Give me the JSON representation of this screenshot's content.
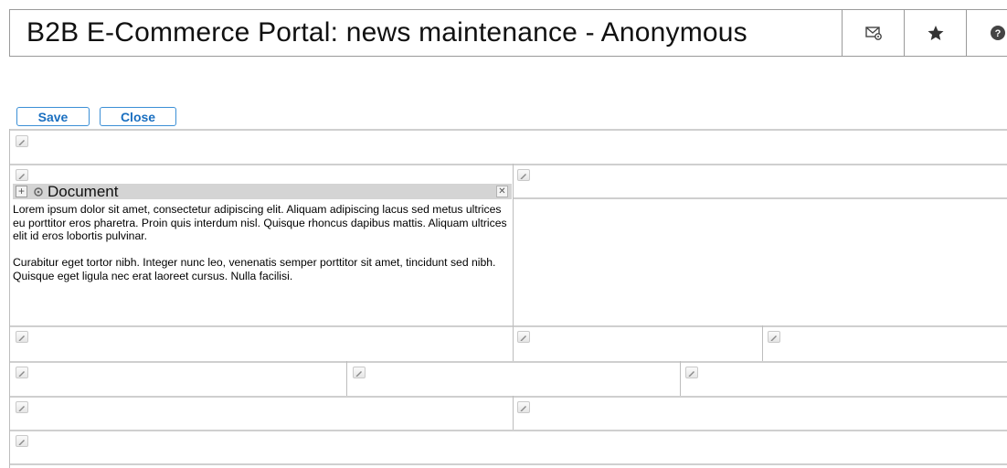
{
  "header": {
    "title": "B2B E-Commerce Portal: news maintenance - Anonymous",
    "icons": [
      "mail-settings-icon",
      "star-icon",
      "help-icon"
    ]
  },
  "toolbar": {
    "save_label": "Save",
    "close_label": "Close"
  },
  "document": {
    "title": "Document",
    "paragraphs": [
      "Lorem ipsum dolor sit amet, consectetur adipiscing elit. Aliquam adipiscing lacus sed metus ultrices eu porttitor eros pharetra. Proin quis interdum nisl. Quisque rhoncus dapibus mattis. Aliquam ultrices elit id eros lobortis pulvinar.",
      "Curabitur eget tortor nibh. Integer nunc leo, venenatis semper porttitor sit amet, tincidunt sed nibh. Quisque eget ligula nec erat laoreet cursus. Nulla facilisi."
    ]
  },
  "colors": {
    "button_border": "#3b8fd6",
    "button_text": "#1a6fc0",
    "portlet_bar": "#d4d4d4",
    "divider": "#cfcfcf"
  }
}
